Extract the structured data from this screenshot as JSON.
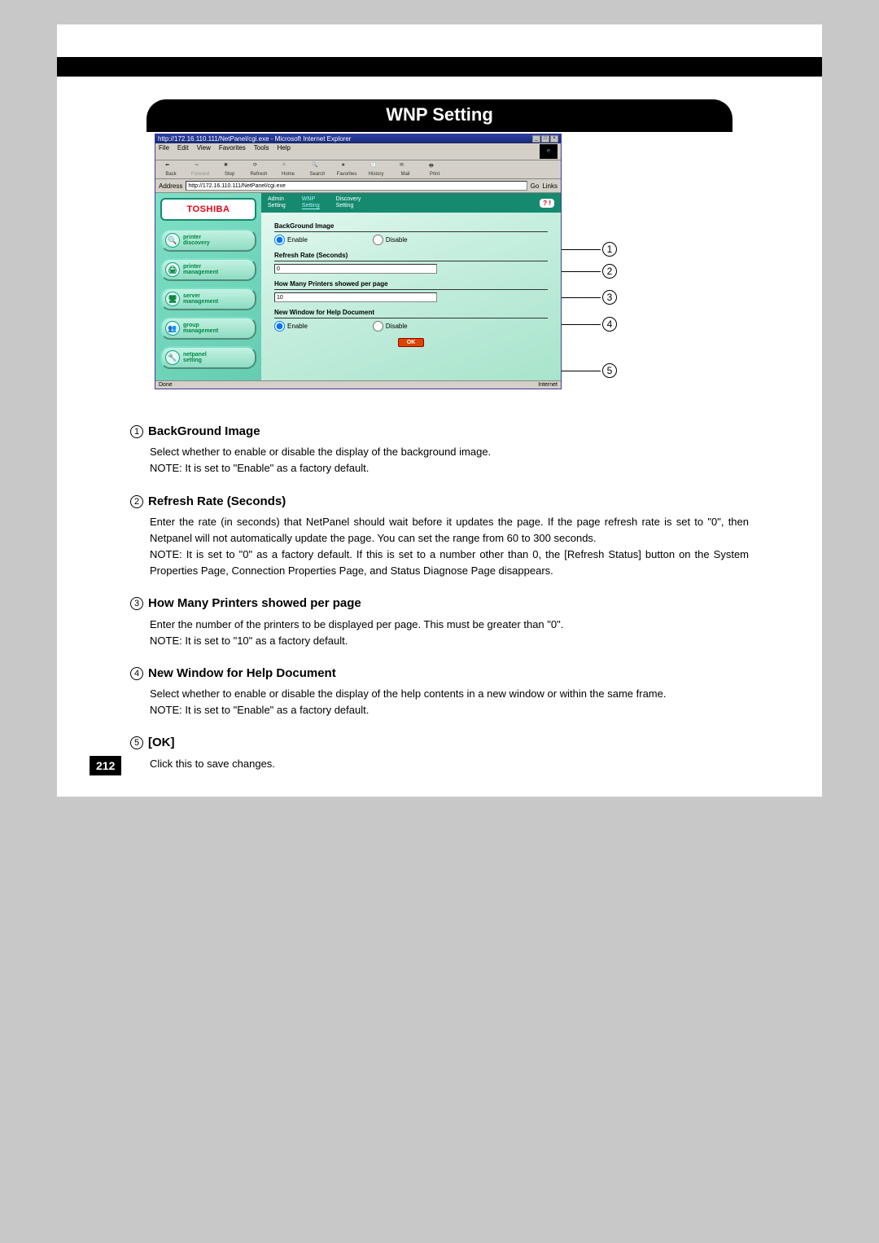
{
  "page_title": "WNP Setting",
  "page_number": "212",
  "browser": {
    "title": "http://172.16.110.111/NetPanel/cgi.exe - Microsoft Internet Explorer",
    "menu": [
      "File",
      "Edit",
      "View",
      "Favorites",
      "Tools",
      "Help"
    ],
    "toolbar": [
      "Back",
      "Forward",
      "Stop",
      "Refresh",
      "Home",
      "Search",
      "Favorites",
      "History",
      "Mail",
      "Print"
    ],
    "address_label": "Address",
    "address_value": "http://172.16.110.111/NetPanel/cgi.exe",
    "go": "Go",
    "links": "Links",
    "status_left": "Done",
    "status_right": "Internet"
  },
  "brand": "TOSHIBA",
  "sidebar_items": [
    {
      "label": "printer\ndiscovery",
      "glyph": "🔍"
    },
    {
      "label": "printer\nmanagement",
      "glyph": "🖨"
    },
    {
      "label": "server\nmanagement",
      "glyph": "🖥"
    },
    {
      "label": "group\nmanagement",
      "glyph": "👥"
    },
    {
      "label": "netpanel\nsetting",
      "glyph": "🔧"
    }
  ],
  "tabs": [
    {
      "label": "Admin\nSetting"
    },
    {
      "label": "WNP\nSetting"
    },
    {
      "label": "Discovery\nSetting"
    }
  ],
  "help_badge": "? !",
  "form": {
    "bg_image_label": "BackGround Image",
    "enable": "Enable",
    "disable": "Disable",
    "refresh_label": "Refresh Rate (Seconds)",
    "refresh_value": "0",
    "printers_label": "How Many Printers showed per page",
    "printers_value": "10",
    "newwin_label": "New Window for Help Document",
    "ok": "OK"
  },
  "callouts": [
    "1",
    "2",
    "3",
    "4",
    "5"
  ],
  "descriptions": [
    {
      "num": "1",
      "title": "BackGround Image",
      "lines": [
        "Select whether to enable or disable the display of the background image.",
        "NOTE: It is set to \"Enable\" as a factory default."
      ]
    },
    {
      "num": "2",
      "title": "Refresh Rate (Seconds)",
      "lines": [
        "Enter the rate (in seconds) that NetPanel should wait before it updates the page. If the page refresh rate is set to \"0\", then Netpanel will not automatically update the page.  You can set the range from 60 to 300 seconds.",
        "NOTE: It is set to \"0\" as a factory default.  If this is set to a number other than 0, the [Refresh Status] button on the System Properties Page, Connection Properties Page, and Status Diagnose Page disappears."
      ]
    },
    {
      "num": "3",
      "title": "How Many Printers showed per page",
      "lines": [
        "Enter the number of the printers to be displayed per page.  This must be greater than \"0\".",
        "NOTE: It is set to \"10\" as a factory default."
      ]
    },
    {
      "num": "4",
      "title": "New Window for Help Document",
      "lines": [
        "Select whether to enable or disable the display of the help contents in a new window or within the same frame.",
        "NOTE: It is set to \"Enable\" as a factory default."
      ]
    },
    {
      "num": "5",
      "title": "[OK]",
      "lines": [
        "Click this to save changes."
      ]
    }
  ]
}
